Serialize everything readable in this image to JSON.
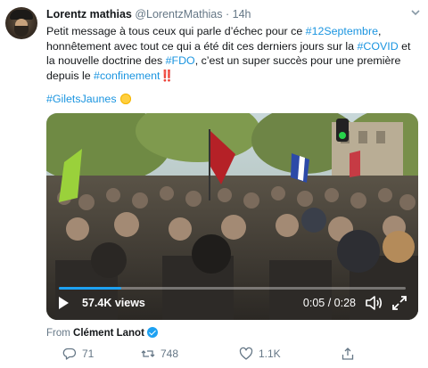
{
  "tweet": {
    "author_name": "Lorentz mathias",
    "handle": "@LorentzMathias",
    "separator": "·",
    "time": "14h",
    "text_parts": [
      {
        "t": "Petit message à tous ceux qui parle d’échec pour ce ",
        "tag": false
      },
      {
        "t": "#12Septembre",
        "tag": true
      },
      {
        "t": ", honnêtement avec tout ce qui a été dit ces derniers jours sur la ",
        "tag": false
      },
      {
        "t": "#COVID",
        "tag": true
      },
      {
        "t": " et la nouvelle doctrine des ",
        "tag": false
      },
      {
        "t": "#FDO",
        "tag": true
      },
      {
        "t": ", c’est un super succès pour une première depuis le ",
        "tag": false
      },
      {
        "t": "#confinement",
        "tag": true
      },
      {
        "t": "‼️",
        "tag": false
      }
    ],
    "hashtag_line": "#GiletsJaunes",
    "media": {
      "views": "57.4K views",
      "time_readout": "0:05 / 0:28",
      "progress_fraction": 0.18
    },
    "from_prefix": "From",
    "from_author": "Clément Lanot",
    "actions": {
      "replies": "71",
      "retweets": "748",
      "likes": "1.1K"
    },
    "colors": {
      "link": "#1b95e0",
      "secondary": "#657786",
      "verified": "#1da1f2"
    },
    "icons": [
      "chevron-down-icon",
      "play-icon",
      "volume-icon",
      "fullscreen-icon",
      "verified-badge-icon",
      "reply-icon",
      "retweet-icon",
      "like-icon",
      "share-icon"
    ]
  }
}
